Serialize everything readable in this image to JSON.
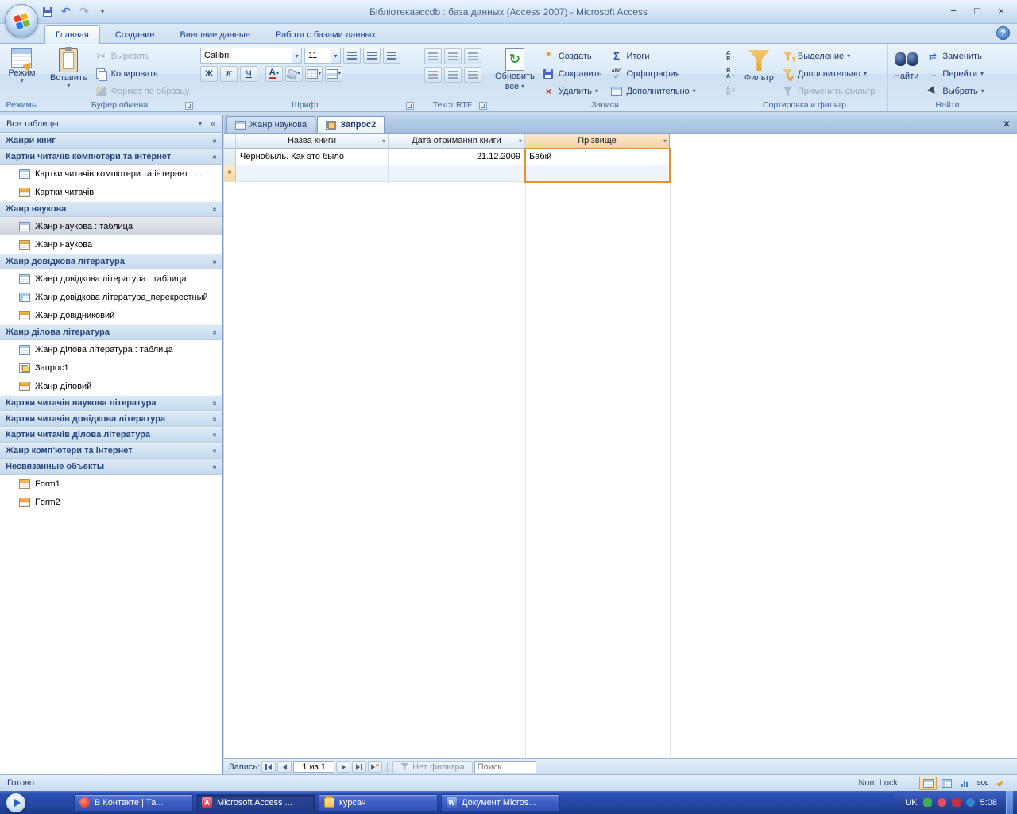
{
  "window": {
    "title": "Бібліотекаaccdb : база данных (Access 2007) - Microsoft Access"
  },
  "ribbon": {
    "tabs": [
      {
        "label": "Главная",
        "active": true
      },
      {
        "label": "Создание",
        "active": false
      },
      {
        "label": "Внешние данные",
        "active": false
      },
      {
        "label": "Работа с базами данных",
        "active": false
      }
    ],
    "views": {
      "label": "Режимы",
      "view": "Режим"
    },
    "clipboard": {
      "label": "Буфер обмена",
      "paste": "Вставить",
      "cut": "Вырезать",
      "copy": "Копировать",
      "painter": "Формат по образцу"
    },
    "font": {
      "label": "Шрифт",
      "name": "Calibri",
      "size": "11",
      "bold": "Ж",
      "italic": "К",
      "underline": "Ч",
      "color_letter": "А"
    },
    "rtf": {
      "label": "Текст RTF"
    },
    "records": {
      "label": "Записи",
      "refresh_line1": "Обновить",
      "refresh_line2": "все",
      "create": "Создать",
      "save": "Сохранить",
      "del": "Удалить",
      "totals": "Итоги",
      "totals_glyph": "Σ",
      "spelling": "Орфография",
      "more": "Дополнительно"
    },
    "sort": {
      "label": "Сортировка и фильтр",
      "filter": "Фильтр",
      "selection": "Выделение",
      "advanced": "Дополнительно",
      "toggle": "Применить фильтр",
      "letter_a": "А",
      "letter_z": "Я"
    },
    "find": {
      "label": "Найти",
      "find": "Найти",
      "replace": "Заменить",
      "goto": "Перейти",
      "select": "Выбрать"
    },
    "help_glyph": "?"
  },
  "navpane": {
    "title": "Все таблицы",
    "groups": [
      {
        "title": "Жанри книг",
        "expanded": false,
        "items": []
      },
      {
        "title": "Картки читачів компютери та інтернет",
        "expanded": true,
        "items": [
          {
            "label": "Картки читачів компютери та інтернет : ...",
            "icon": "table-icon"
          },
          {
            "label": "Картки читачів",
            "icon": "form-icon"
          }
        ]
      },
      {
        "title": "Жанр наукова",
        "expanded": true,
        "items": [
          {
            "label": "Жанр наукова : таблица",
            "icon": "table-icon",
            "selected": true
          },
          {
            "label": "Жанр наукова",
            "icon": "form-icon"
          }
        ]
      },
      {
        "title": "Жанр довідкова література",
        "expanded": true,
        "items": [
          {
            "label": "Жанр довідкова література : таблица",
            "icon": "table-icon"
          },
          {
            "label": "Жанр довідкова література_перекрестный",
            "icon": "crosstab-icon"
          },
          {
            "label": "Жанр довідниковий",
            "icon": "form-icon"
          }
        ]
      },
      {
        "title": "Жанр ділова література",
        "expanded": true,
        "items": [
          {
            "label": "Жанр ділова література : таблица",
            "icon": "table-icon"
          },
          {
            "label": "Запрос1",
            "icon": "query-icon"
          },
          {
            "label": "Жанр діловий",
            "icon": "form-icon"
          }
        ]
      },
      {
        "title": "Картки читачів наукова література",
        "expanded": false,
        "items": []
      },
      {
        "title": "Картки читачів довідкова література",
        "expanded": false,
        "items": []
      },
      {
        "title": "Картки читачів ділова література",
        "expanded": false,
        "items": []
      },
      {
        "title": "Жанр комп'ютери та інтернет",
        "expanded": false,
        "items": []
      },
      {
        "title": "Несвязанные объекты",
        "expanded": true,
        "items": [
          {
            "label": "Form1",
            "icon": "form-icon"
          },
          {
            "label": "Form2",
            "icon": "form-icon"
          }
        ]
      }
    ]
  },
  "doc": {
    "tabs": [
      {
        "label": "Жанр наукова",
        "active": false,
        "icon": "table-icon"
      },
      {
        "label": "Запрос2",
        "active": true,
        "icon": "query-icon"
      }
    ],
    "datasheet": {
      "columns": [
        {
          "name": "Назва книги",
          "selected": false
        },
        {
          "name": "Дата отримання книги",
          "selected": false
        },
        {
          "name": "Прізвище",
          "selected": true
        }
      ],
      "rows": [
        {
          "book": "Чернобыль. Как это было",
          "date": "21.12.2009",
          "surname": "Бабій"
        }
      ],
      "new_marker": "*"
    },
    "recnav": {
      "label": "Запись:",
      "value": "1 из 1",
      "filter": "Нет фильтра",
      "search": "Поиск"
    }
  },
  "status": {
    "ready": "Готово",
    "numlock": "Num Lock",
    "sql": "SQL"
  },
  "taskbar": {
    "tasks": [
      {
        "label": "В Контакте | Та...",
        "active": false
      },
      {
        "label": "Microsoft Access ...",
        "active": true
      },
      {
        "label": "курсач",
        "active": false
      },
      {
        "label": "Документ Micros...",
        "active": false
      }
    ],
    "lang": "UK",
    "time": "5:08"
  }
}
